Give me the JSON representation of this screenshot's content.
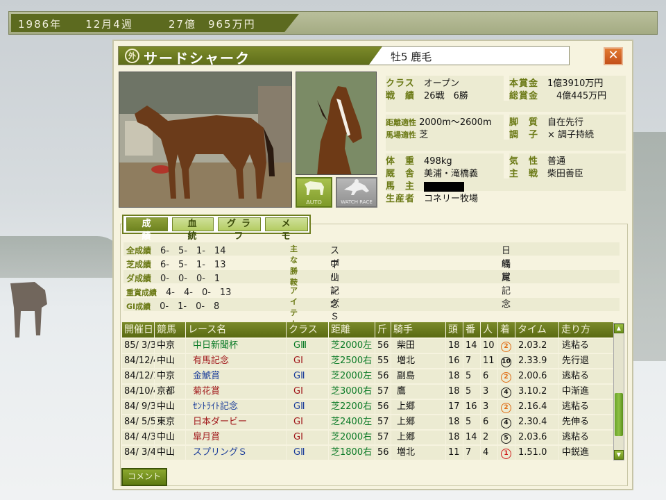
{
  "topbar": {
    "year": "1986年",
    "week": "12月4週",
    "money": "27億　965万円"
  },
  "horse": {
    "badge": "外",
    "name": "サードシャーク",
    "sex_age_color": "牡5 鹿毛"
  },
  "buttons": {
    "close": "✕",
    "auto": "AUTO",
    "watch_race": "WATCH RACE",
    "comment": "コメント"
  },
  "profile": {
    "class_label": "クラス",
    "class": "オープン",
    "record_label": "戦　績",
    "record": "26戦　6勝",
    "prize_label": "本賞金",
    "prize": "1億3910万円",
    "total_prize_label": "総賞金",
    "total_prize": "4億445万円",
    "distance_label": "距離適性",
    "distance": "2000m～2600m",
    "ashishitsu_label": "脚　質",
    "ashishitsu": "自在先行",
    "surface_label": "馬場適性",
    "surface": "芝",
    "condition_label": "調　子",
    "condition": "× 調子持続",
    "weight_label": "体　重",
    "weight": "498kg",
    "temper_label": "気　性",
    "temper": "普通",
    "stable_label": "厩　舎",
    "stable": "美浦・滝橋義",
    "jockey_label": "主　戦",
    "jockey": "柴田善臣",
    "owner_label": "馬　主",
    "breeder_label": "生産者",
    "breeder": "コネリー牧場"
  },
  "tabs": [
    "成　績",
    "血　統",
    "グラフ",
    "メ　モ"
  ],
  "stats": {
    "all_label": "全成績",
    "all": "6-　5-　1-　14",
    "turf_label": "芝成績",
    "turf": "6-　5-　1-　13",
    "dirt_label": "ダ成績",
    "dirt": "0-　0-　0-　1",
    "graded_label": "重賞成績",
    "graded": "4-　4-　0-　13",
    "g1_label": "GⅠ成績",
    "g1": "0-　1-　0-　8",
    "wins_label": "主な勝鞍",
    "wins": [
      "スプリングＳ",
      "日経賞",
      "中山記念",
      "鳴尾記念"
    ],
    "item_label": "アイテム"
  },
  "table": {
    "headers": [
      "開催日",
      "競馬場",
      "レース名",
      "クラス",
      "距離",
      "斤",
      "騎手",
      "頭",
      "番",
      "人",
      "着",
      "タイム",
      "走り方"
    ],
    "rows": [
      {
        "date": "85/ 3/3",
        "course": "中京",
        "race": "中日新聞杯",
        "rc": "green",
        "cls": "GⅢ",
        "cc": "g3",
        "dist": "芝2000左",
        "kin": "56",
        "jockey": "柴田",
        "n": "18",
        "ban": "14",
        "pop": "10",
        "pos": "2",
        "pc": "orange",
        "time": "2.03.2",
        "style": "逃粘る"
      },
      {
        "date": "84/12/4",
        "course": "中山",
        "race": "有馬記念",
        "rc": "red",
        "cls": "GⅠ",
        "cc": "g1",
        "dist": "芝2500右",
        "kin": "55",
        "jockey": "増北",
        "n": "16",
        "ban": "7",
        "pop": "11",
        "pos": "10",
        "pc": "black",
        "time": "2.33.9",
        "style": "先行退"
      },
      {
        "date": "84/12/1",
        "course": "中京",
        "race": "金鯱賞",
        "rc": "blue",
        "cls": "GⅡ",
        "cc": "g2",
        "dist": "芝2000左",
        "kin": "56",
        "jockey": "副島",
        "n": "18",
        "ban": "5",
        "pop": "6",
        "pos": "2",
        "pc": "orange",
        "time": "2.00.6",
        "style": "逃粘る"
      },
      {
        "date": "84/10/4",
        "course": "京都",
        "race": "菊花賞",
        "rc": "red",
        "cls": "GⅠ",
        "cc": "g1",
        "dist": "芝3000右",
        "kin": "57",
        "jockey": "鷹",
        "n": "18",
        "ban": "5",
        "pop": "3",
        "pos": "4",
        "pc": "black",
        "time": "3.10.2",
        "style": "中渐進"
      },
      {
        "date": "84/ 9/3",
        "course": "中山",
        "race": "ｾﾝﾄﾗｲﾄ記念",
        "rc": "blue",
        "cls": "GⅡ",
        "cc": "g2",
        "dist": "芝2200右",
        "kin": "56",
        "jockey": "上郷",
        "n": "17",
        "ban": "16",
        "pop": "3",
        "pos": "2",
        "pc": "orange",
        "time": "2.16.4",
        "style": "逃粘る"
      },
      {
        "date": "84/ 5/5",
        "course": "東京",
        "race": "日本ダービー",
        "rc": "red",
        "cls": "GⅠ",
        "cc": "g1",
        "dist": "芝2400左",
        "kin": "57",
        "jockey": "上郷",
        "n": "18",
        "ban": "5",
        "pop": "6",
        "pos": "4",
        "pc": "black",
        "time": "2.30.4",
        "style": "先伸る"
      },
      {
        "date": "84/ 4/3",
        "course": "中山",
        "race": "皐月賞",
        "rc": "red",
        "cls": "GⅠ",
        "cc": "g1",
        "dist": "芝2000右",
        "kin": "57",
        "jockey": "上郷",
        "n": "18",
        "ban": "14",
        "pop": "2",
        "pos": "5",
        "pc": "black",
        "time": "2.03.6",
        "style": "逃粘る"
      },
      {
        "date": "84/ 3/4",
        "course": "中山",
        "race": "スプリングＳ",
        "rc": "blue",
        "cls": "GⅡ",
        "cc": "g2",
        "dist": "芝1800右",
        "kin": "56",
        "jockey": "増北",
        "n": "11",
        "ban": "7",
        "pop": "4",
        "pos": "1",
        "pc": "red",
        "time": "1.51.0",
        "style": "中鋭進"
      }
    ]
  }
}
